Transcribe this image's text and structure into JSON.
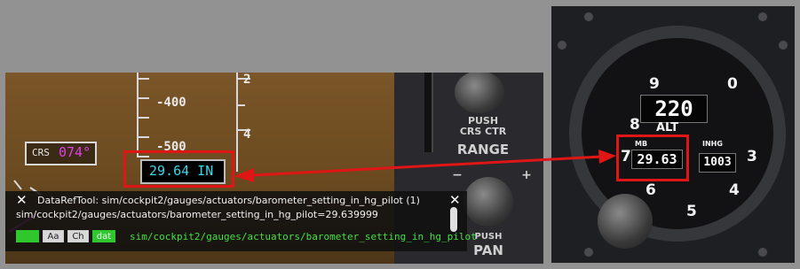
{
  "pfd": {
    "tape_labels": [
      "-400",
      "-500"
    ],
    "scale_labels": [
      "2",
      "4"
    ],
    "crs_label": "CRS",
    "crs_value": "074°",
    "baro_value": "29.64 IN"
  },
  "panel": {
    "push_crs_ctr_line1": "PUSH",
    "push_crs_ctr_line2": "CRS CTR",
    "range": "RANGE",
    "push_pan_line1": "PUSH",
    "push_pan_line2": "PAN",
    "plus": "+",
    "minus": "−"
  },
  "dataref_tool": {
    "close_label": "✕",
    "title": "DataRefTool: sim/cockpit2/gauges/actuators/barometer_setting_in_hg_pilot (1)",
    "value_line": "sim/cockpit2/gauges/actuators/barometer_setting_in_hg_pilot=29.639999",
    "buttons": [
      "Aa",
      "Ch",
      "dat"
    ],
    "dataref_path": "sim/cockpit2/gauges/actuators/barometer_setting_in_hg_pilot"
  },
  "altimeter": {
    "dial_numbers": [
      "9",
      "0",
      "8",
      "7",
      "3",
      "6",
      "5",
      "4"
    ],
    "alt_readout": "220",
    "alt_label": "ALT",
    "mb_label": "MB",
    "inhg_label": "INHG",
    "inhg_readout": "29.63",
    "mb_readout": "1003"
  },
  "colors": {
    "highlight": "#e01515",
    "magenta": "#e040e8",
    "cyan": "#38d8e8",
    "dataref_green": "#44e044"
  }
}
